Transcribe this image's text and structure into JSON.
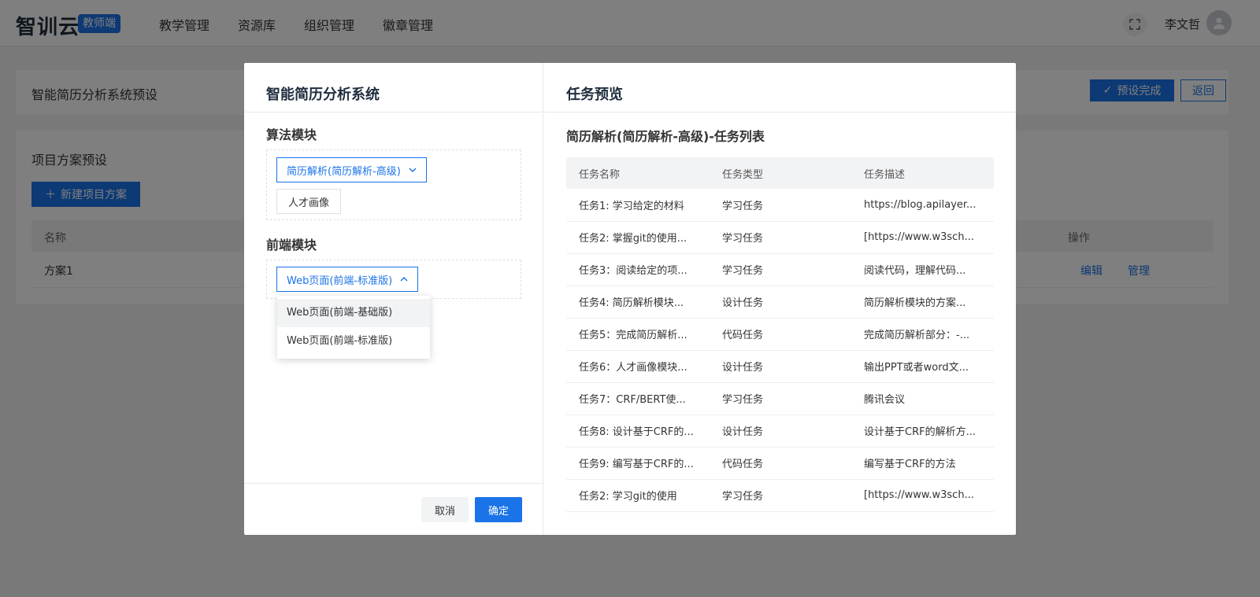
{
  "header": {
    "logo": "智训云",
    "badge": "教师端",
    "nav": [
      "教学管理",
      "资源库",
      "组织管理",
      "徽章管理"
    ],
    "user_name": "李文哲",
    "icons": {
      "fullscreen": "fullscreen-icon",
      "avatar": "user-avatar-icon"
    }
  },
  "preset_panel": {
    "title": "智能简历分析系统预设",
    "done_label": "预设完成",
    "back_label": "返回"
  },
  "project_panel": {
    "title": "项目方案预设",
    "new_label": "新建项目方案",
    "columns": {
      "name": "名称",
      "ops": "操作"
    },
    "rows": [
      {
        "name": "方案1",
        "edit": "编辑",
        "manage": "管理"
      }
    ]
  },
  "modal": {
    "left_title": "智能简历分析系统",
    "algo_section": {
      "title": "算法模块",
      "selected": "简历解析(简历解析-高级)",
      "extra_tag": "人才画像"
    },
    "frontend_section": {
      "title": "前端模块",
      "selected": "Web页面(前端-标准版)",
      "options": [
        "Web页面(前端-基础版)",
        "Web页面(前端-标准版)"
      ]
    },
    "cancel_label": "取消",
    "ok_label": "确定",
    "right_title": "任务预览",
    "task_list_title": "简历解析(简历解析-高级)-任务列表",
    "task_columns": [
      "任务名称",
      "任务类型",
      "任务描述"
    ],
    "tasks": [
      [
        "任务1: 学习给定的材料",
        "学习任务",
        "https://blog.apilayer..."
      ],
      [
        "任务2: 掌握git的使用...",
        "学习任务",
        "[https://www.w3sch..."
      ],
      [
        "任务3：阅读给定的项...",
        "学习任务",
        "阅读代码，理解代码..."
      ],
      [
        "任务4: 简历解析模块...",
        "设计任务",
        "简历解析模块的方案..."
      ],
      [
        "任务5：完成简历解析...",
        "代码任务",
        "完成简历解析部分：-..."
      ],
      [
        "任务6：人才画像模块...",
        "设计任务",
        "输出PPT或者word文..."
      ],
      [
        "任务7：CRF/BERT使...",
        "学习任务",
        "腾讯会议"
      ],
      [
        "任务8: 设计基于CRF的...",
        "设计任务",
        "设计基于CRF的解析方..."
      ],
      [
        "任务9: 编写基于CRF的...",
        "代码任务",
        "编写基于CRF的方法"
      ],
      [
        "任务2: 学习git的使用",
        "学习任务",
        "[https://www.w3sch..."
      ]
    ]
  }
}
